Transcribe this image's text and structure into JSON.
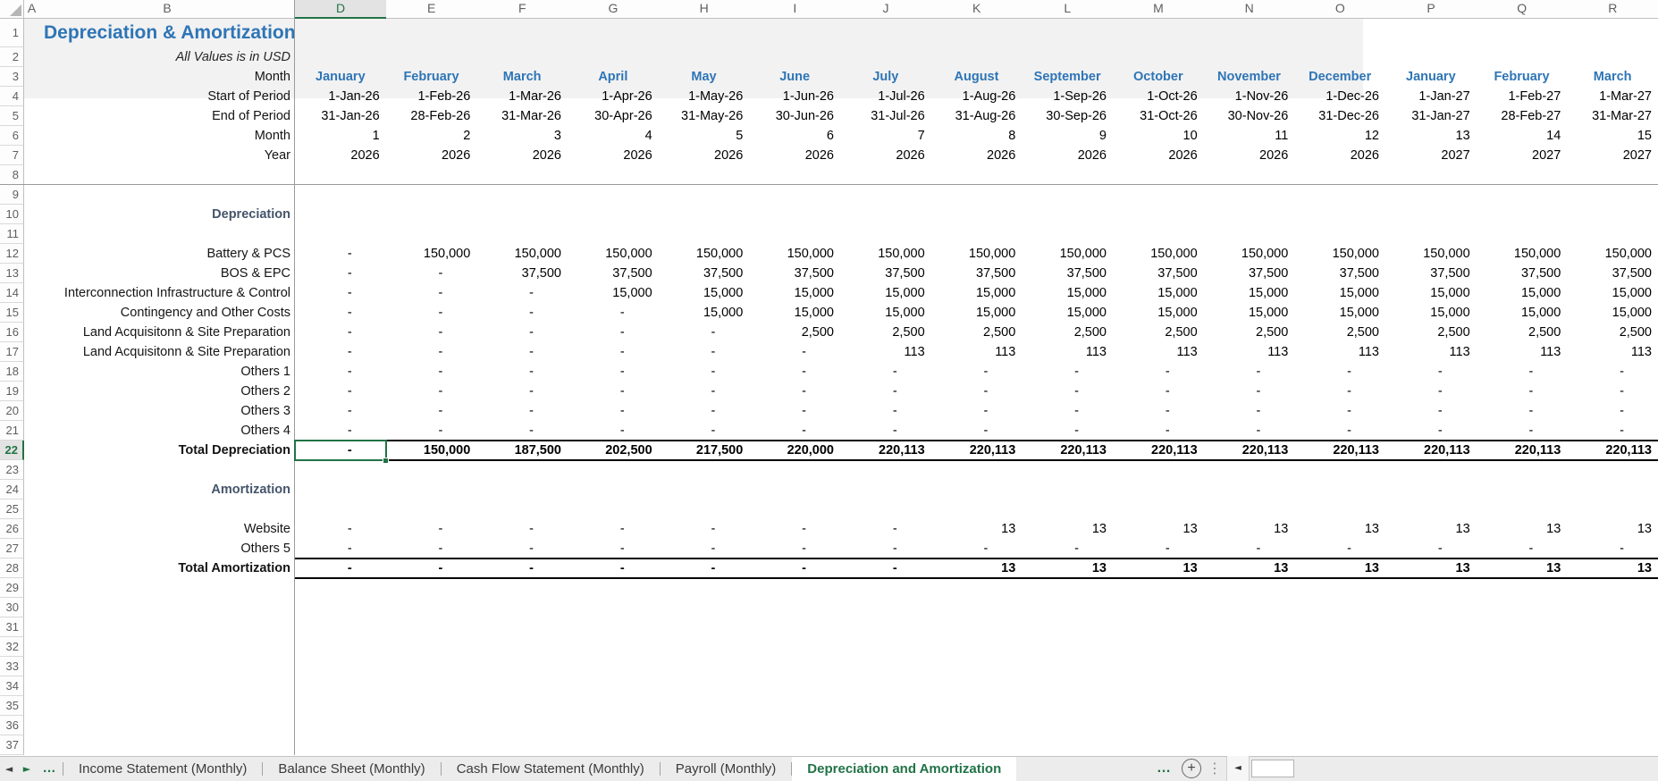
{
  "app": {
    "kind": "spreadsheet",
    "accent_green": "#217346",
    "accent_blue": "#2E75B6",
    "section_navy": "#44546A",
    "header_fill": "#F2F2F2"
  },
  "title": "Depreciation & Amortization",
  "subtitle": "All Values is in USD",
  "grid": {
    "column_letters": [
      "A",
      "B",
      "D",
      "E",
      "F",
      "G",
      "H",
      "I",
      "J",
      "K",
      "L",
      "M",
      "N",
      "O",
      "P",
      "Q",
      "R"
    ],
    "selected_column": "D",
    "selected_row": 22,
    "row_count": 37,
    "active_cell": "D22",
    "active_cell_value": "-"
  },
  "header_rows": {
    "month_label": "Month",
    "start_label": "Start of Period",
    "end_label": "End of Period",
    "month_num_label": "Month",
    "year_label": "Year"
  },
  "months": [
    {
      "name": "January",
      "start": "1-Jan-26",
      "end": "31-Jan-26",
      "num": "1",
      "year": "2026"
    },
    {
      "name": "February",
      "start": "1-Feb-26",
      "end": "28-Feb-26",
      "num": "2",
      "year": "2026"
    },
    {
      "name": "March",
      "start": "1-Mar-26",
      "end": "31-Mar-26",
      "num": "3",
      "year": "2026"
    },
    {
      "name": "April",
      "start": "1-Apr-26",
      "end": "30-Apr-26",
      "num": "4",
      "year": "2026"
    },
    {
      "name": "May",
      "start": "1-May-26",
      "end": "31-May-26",
      "num": "5",
      "year": "2026"
    },
    {
      "name": "June",
      "start": "1-Jun-26",
      "end": "30-Jun-26",
      "num": "6",
      "year": "2026"
    },
    {
      "name": "July",
      "start": "1-Jul-26",
      "end": "31-Jul-26",
      "num": "7",
      "year": "2026"
    },
    {
      "name": "August",
      "start": "1-Aug-26",
      "end": "31-Aug-26",
      "num": "8",
      "year": "2026"
    },
    {
      "name": "September",
      "start": "1-Sep-26",
      "end": "30-Sep-26",
      "num": "9",
      "year": "2026"
    },
    {
      "name": "October",
      "start": "1-Oct-26",
      "end": "31-Oct-26",
      "num": "10",
      "year": "2026"
    },
    {
      "name": "November",
      "start": "1-Nov-26",
      "end": "30-Nov-26",
      "num": "11",
      "year": "2026"
    },
    {
      "name": "December",
      "start": "1-Dec-26",
      "end": "31-Dec-26",
      "num": "12",
      "year": "2026"
    },
    {
      "name": "January",
      "start": "1-Jan-27",
      "end": "31-Jan-27",
      "num": "13",
      "year": "2027"
    },
    {
      "name": "February",
      "start": "1-Feb-27",
      "end": "28-Feb-27",
      "num": "14",
      "year": "2027"
    },
    {
      "name": "March",
      "start": "1-Mar-27",
      "end": "31-Mar-27",
      "num": "15",
      "year": "2027"
    }
  ],
  "sections": [
    {
      "row": 10,
      "title": "Depreciation"
    },
    {
      "row": 24,
      "title": "Amortization"
    }
  ],
  "data_rows": [
    {
      "row": 12,
      "label": "Battery & PCS",
      "values": [
        "-",
        "150,000",
        "150,000",
        "150,000",
        "150,000",
        "150,000",
        "150,000",
        "150,000",
        "150,000",
        "150,000",
        "150,000",
        "150,000",
        "150,000",
        "150,000",
        "150,000"
      ]
    },
    {
      "row": 13,
      "label": "BOS & EPC",
      "values": [
        "-",
        "-",
        "37,500",
        "37,500",
        "37,500",
        "37,500",
        "37,500",
        "37,500",
        "37,500",
        "37,500",
        "37,500",
        "37,500",
        "37,500",
        "37,500",
        "37,500"
      ]
    },
    {
      "row": 14,
      "label": "Interconnection Infrastructure & Control",
      "values": [
        "-",
        "-",
        "-",
        "15,000",
        "15,000",
        "15,000",
        "15,000",
        "15,000",
        "15,000",
        "15,000",
        "15,000",
        "15,000",
        "15,000",
        "15,000",
        "15,000"
      ]
    },
    {
      "row": 15,
      "label": "Contingency and Other Costs",
      "values": [
        "-",
        "-",
        "-",
        "-",
        "15,000",
        "15,000",
        "15,000",
        "15,000",
        "15,000",
        "15,000",
        "15,000",
        "15,000",
        "15,000",
        "15,000",
        "15,000"
      ]
    },
    {
      "row": 16,
      "label": "Land Acquisitonn & Site Preparation",
      "values": [
        "-",
        "-",
        "-",
        "-",
        "-",
        "2,500",
        "2,500",
        "2,500",
        "2,500",
        "2,500",
        "2,500",
        "2,500",
        "2,500",
        "2,500",
        "2,500"
      ]
    },
    {
      "row": 17,
      "label": "Land Acquisitonn & Site Preparation",
      "values": [
        "-",
        "-",
        "-",
        "-",
        "-",
        "-",
        "113",
        "113",
        "113",
        "113",
        "113",
        "113",
        "113",
        "113",
        "113"
      ]
    },
    {
      "row": 18,
      "label": "Others 1",
      "values": [
        "-",
        "-",
        "-",
        "-",
        "-",
        "-",
        "-",
        "-",
        "-",
        "-",
        "-",
        "-",
        "-",
        "-",
        "-"
      ]
    },
    {
      "row": 19,
      "label": "Others 2",
      "values": [
        "-",
        "-",
        "-",
        "-",
        "-",
        "-",
        "-",
        "-",
        "-",
        "-",
        "-",
        "-",
        "-",
        "-",
        "-"
      ]
    },
    {
      "row": 20,
      "label": "Others 3",
      "values": [
        "-",
        "-",
        "-",
        "-",
        "-",
        "-",
        "-",
        "-",
        "-",
        "-",
        "-",
        "-",
        "-",
        "-",
        "-"
      ]
    },
    {
      "row": 21,
      "label": "Others 4",
      "values": [
        "-",
        "-",
        "-",
        "-",
        "-",
        "-",
        "-",
        "-",
        "-",
        "-",
        "-",
        "-",
        "-",
        "-",
        "-"
      ]
    },
    {
      "row": 22,
      "label": "Total Depreciation",
      "total": true,
      "values": [
        "-",
        "150,000",
        "187,500",
        "202,500",
        "217,500",
        "220,000",
        "220,113",
        "220,113",
        "220,113",
        "220,113",
        "220,113",
        "220,113",
        "220,113",
        "220,113",
        "220,113"
      ]
    },
    {
      "row": 26,
      "label": "Website",
      "values": [
        "-",
        "-",
        "-",
        "-",
        "-",
        "-",
        "-",
        "13",
        "13",
        "13",
        "13",
        "13",
        "13",
        "13",
        "13"
      ]
    },
    {
      "row": 27,
      "label": "Others 5",
      "values": [
        "-",
        "-",
        "-",
        "-",
        "-",
        "-",
        "-",
        "-",
        "-",
        "-",
        "-",
        "-",
        "-",
        "-",
        "-"
      ]
    },
    {
      "row": 28,
      "label": "Total Amortization",
      "total": true,
      "values": [
        "-",
        "-",
        "-",
        "-",
        "-",
        "-",
        "-",
        "13",
        "13",
        "13",
        "13",
        "13",
        "13",
        "13",
        "13"
      ]
    }
  ],
  "tabbar": {
    "tabs": [
      {
        "label": "Income Statement (Monthly)",
        "active": false
      },
      {
        "label": "Balance Sheet (Monthly)",
        "active": false
      },
      {
        "label": "Cash Flow Statement (Monthly)",
        "active": false
      },
      {
        "label": "Payroll (Monthly)",
        "active": false
      },
      {
        "label": "Depreciation and Amortization",
        "active": true
      }
    ],
    "icons": {
      "nav_left": "◄",
      "nav_right": "►",
      "more_tabs_left": "…",
      "more_tabs_right": "…",
      "add_sheet": "+",
      "kebab": "⋮",
      "scroll_left": "◄"
    }
  }
}
